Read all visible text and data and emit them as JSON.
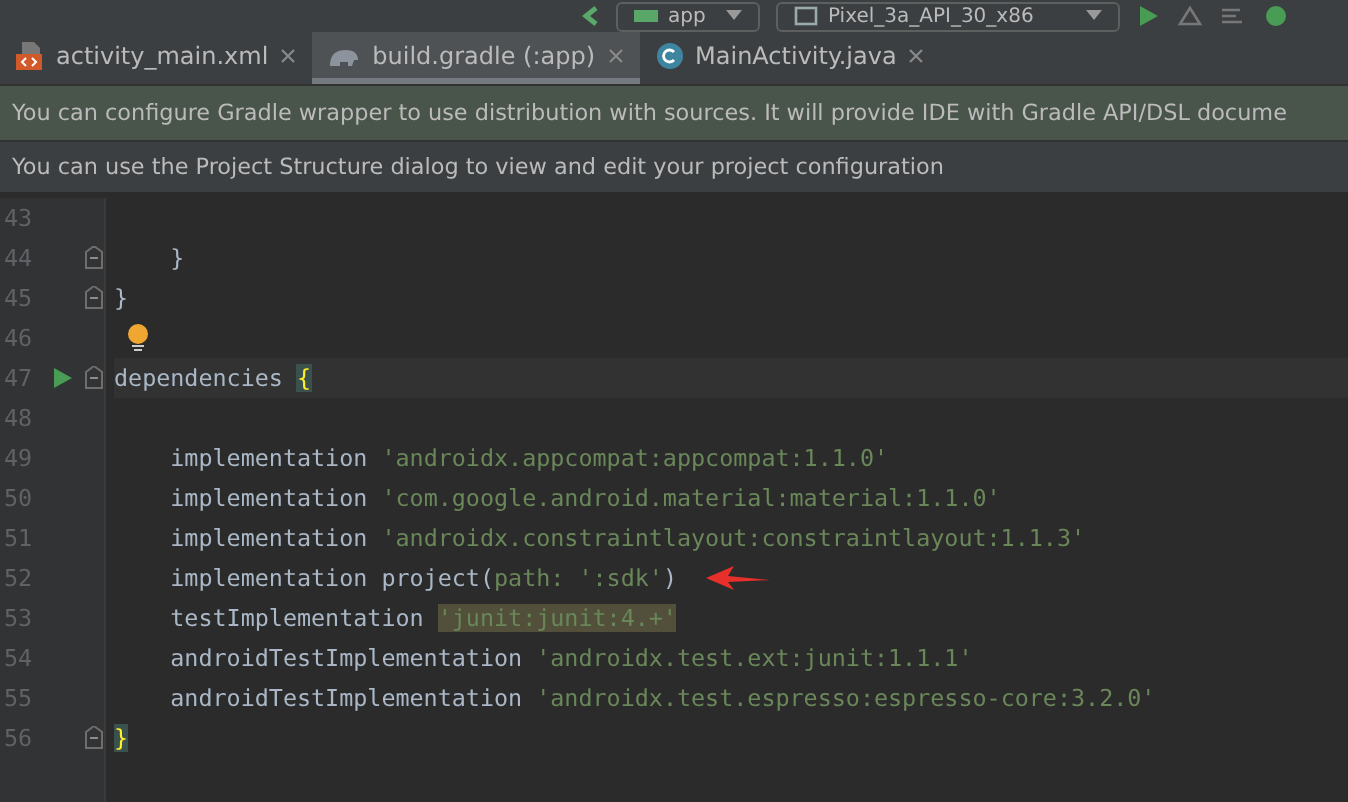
{
  "toolbar": {
    "run_config": "app",
    "device": "Pixel_3a_API_30_x86"
  },
  "tabs": [
    {
      "label": "activity_main.xml",
      "kind": "xml",
      "selected": false
    },
    {
      "label": "build.gradle (:app)",
      "kind": "gradle",
      "selected": true
    },
    {
      "label": "MainActivity.java",
      "kind": "java",
      "selected": false
    }
  ],
  "banners": [
    {
      "text": "You can configure Gradle wrapper to use distribution with sources. It will provide IDE with Gradle API/DSL docume",
      "kind": "green"
    },
    {
      "text": "You can use the Project Structure dialog to view and edit your project configuration",
      "kind": "plain"
    }
  ],
  "editor": {
    "lines": [
      {
        "number": "43"
      },
      {
        "number": "44",
        "fold": true,
        "tokens": [
          {
            "kind": "plain",
            "text": "    }"
          }
        ]
      },
      {
        "number": "45",
        "fold": true,
        "tokens": [
          {
            "kind": "plain",
            "text": "}"
          }
        ]
      },
      {
        "number": "46",
        "bulb": true
      },
      {
        "number": "47",
        "fold": true,
        "run": true,
        "current": true,
        "tokens": [
          {
            "kind": "plain",
            "text": "dependencies "
          },
          {
            "kind": "brace",
            "text": "{"
          }
        ]
      },
      {
        "number": "48"
      },
      {
        "number": "49",
        "tokens": [
          {
            "kind": "plain",
            "text": "    implementation "
          },
          {
            "kind": "string",
            "text": "'androidx.appcompat:appcompat:1.1.0'"
          }
        ]
      },
      {
        "number": "50",
        "tokens": [
          {
            "kind": "plain",
            "text": "    implementation "
          },
          {
            "kind": "string",
            "text": "'com.google.android.material:material:1.1.0'"
          }
        ]
      },
      {
        "number": "51",
        "tokens": [
          {
            "kind": "plain",
            "text": "    implementation "
          },
          {
            "kind": "string",
            "text": "'androidx.constraintlayout:constraintlayout:1.1.3'"
          }
        ]
      },
      {
        "number": "52",
        "arrow": true,
        "tokens": [
          {
            "kind": "plain",
            "text": "    implementation project("
          },
          {
            "kind": "named",
            "text": "path: "
          },
          {
            "kind": "string",
            "text": "':sdk'"
          },
          {
            "kind": "plain",
            "text": ")"
          }
        ]
      },
      {
        "number": "53",
        "tokens": [
          {
            "kind": "plain",
            "text": "    testImplementation "
          },
          {
            "kind": "warn",
            "text": "'junit:junit:4.+'"
          }
        ]
      },
      {
        "number": "54",
        "tokens": [
          {
            "kind": "plain",
            "text": "    androidTestImplementation "
          },
          {
            "kind": "string",
            "text": "'androidx.test.ext:junit:1.1.1'"
          }
        ]
      },
      {
        "number": "55",
        "tokens": [
          {
            "kind": "plain",
            "text": "    androidTestImplementation "
          },
          {
            "kind": "string",
            "text": "'androidx.test.espresso:espresso-core:3.2.0'"
          }
        ]
      },
      {
        "number": "56",
        "fold": true,
        "tokens": [
          {
            "kind": "brace",
            "text": "}"
          }
        ]
      }
    ]
  }
}
